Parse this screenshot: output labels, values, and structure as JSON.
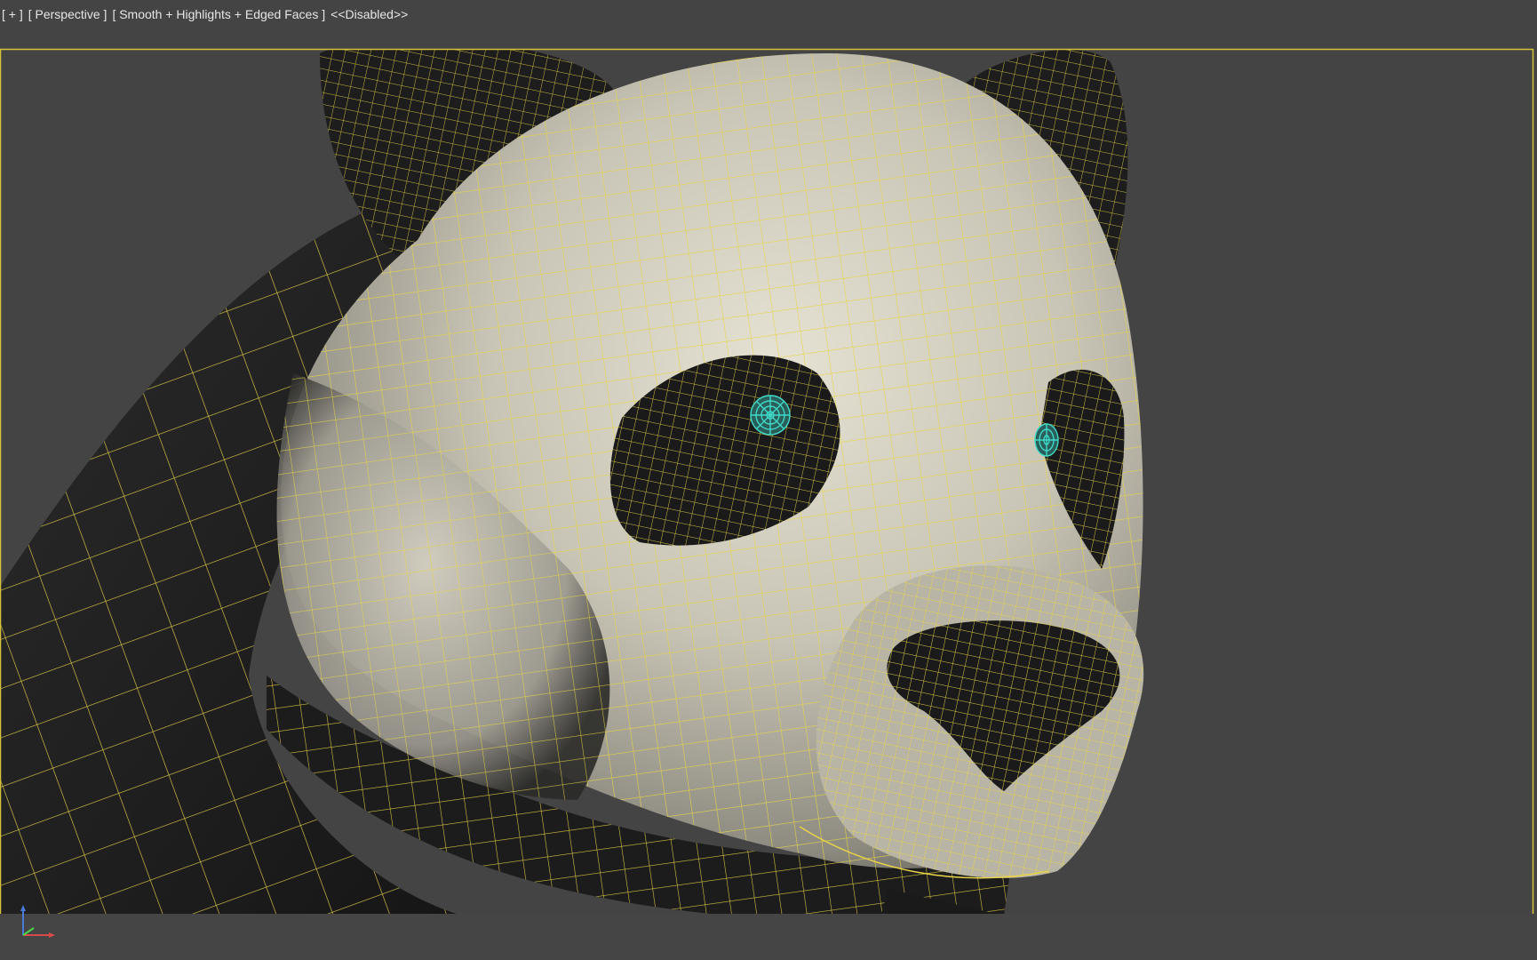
{
  "viewport": {
    "menu_plus": "[ + ]",
    "menu_view": "[ Perspective ]",
    "menu_shading": "[ Smooth + Highlights + Edged Faces ]",
    "menu_disabled": "<<Disabled>>"
  },
  "colors": {
    "background": "#444444",
    "active_border": "#d6c23a",
    "wireframe": "#e8d448",
    "eye_wire": "#3fd9c8",
    "fur_white": "#c7c3b4",
    "fur_black": "#1e1e1e"
  },
  "icons": {
    "axis_gizmo": "xyz-axis-icon"
  }
}
